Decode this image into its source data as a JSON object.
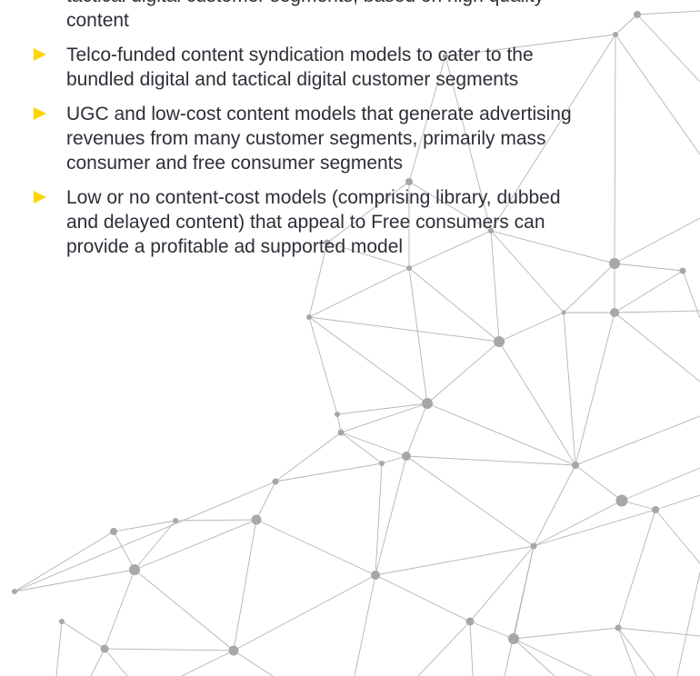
{
  "content": {
    "bullets": [
      {
        "text": "tactical digital customer segments, based on high quality content"
      },
      {
        "text": "Telco-funded content syndication models to cater to the bundled digital and tactical digital customer segments"
      },
      {
        "text": "UGC and low-cost content models that generate advertising revenues from many customer segments, primarily mass consumer and free consumer segments"
      },
      {
        "text": "Low or no content-cost models (comprising library, dubbed and delayed content) that appeal to Free consumers can provide a profitable ad supported model"
      }
    ]
  },
  "icons": {
    "bullet": "yellow-triangle-arrow-icon"
  },
  "colors": {
    "bullet_accent": "#ffd600",
    "text": "#2e2e38",
    "network_line": "#b4b4b4",
    "network_node": "#a7a7a7",
    "background": "#ffffff"
  }
}
